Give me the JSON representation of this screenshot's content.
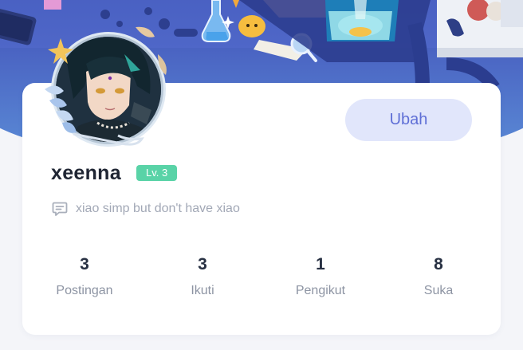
{
  "profile": {
    "username": "xeenna",
    "level": "Lv. 3",
    "bio": "xiao simp but don't have xiao",
    "edit_label": "Ubah"
  },
  "stats": [
    {
      "value": "3",
      "label": "Postingan"
    },
    {
      "value": "3",
      "label": "Ikuti"
    },
    {
      "value": "1",
      "label": "Pengikut"
    },
    {
      "value": "8",
      "label": "Suka"
    }
  ],
  "colors": {
    "accent": "#5f6fd6",
    "button_bg": "#e1e6fb",
    "level_badge": "#59d3a7",
    "banner_blue": "#4f67c8"
  },
  "icons": {
    "bio": "comment-icon"
  }
}
